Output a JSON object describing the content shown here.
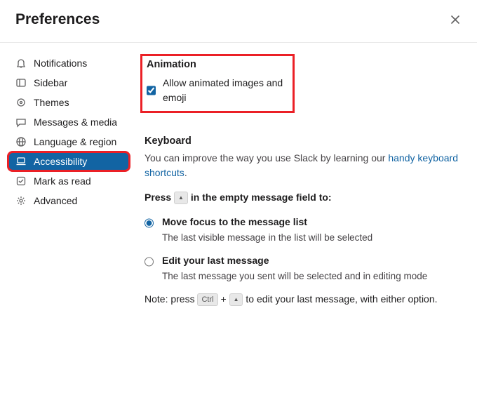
{
  "title": "Preferences",
  "sidebar": {
    "items": [
      {
        "label": "Notifications",
        "icon": "bell-icon",
        "active": false
      },
      {
        "label": "Sidebar",
        "icon": "panel-icon",
        "active": false
      },
      {
        "label": "Themes",
        "icon": "eye-icon",
        "active": false
      },
      {
        "label": "Messages & media",
        "icon": "message-icon",
        "active": false
      },
      {
        "label": "Language & region",
        "icon": "globe-icon",
        "active": false
      },
      {
        "label": "Accessibility",
        "icon": "laptop-icon",
        "active": true
      },
      {
        "label": "Mark as read",
        "icon": "check-icon",
        "active": false
      },
      {
        "label": "Advanced",
        "icon": "gear-icon",
        "active": false
      }
    ]
  },
  "animation": {
    "heading": "Animation",
    "checkbox_label": "Allow animated images and emoji",
    "checked": true
  },
  "keyboard": {
    "heading": "Keyboard",
    "intro": "You can improve the way you use Slack by learning our ",
    "link_text": "handy keyboard shortcuts",
    "press_prefix": "Press",
    "up_key_glyph": "▲",
    "press_suffix": "in the empty message field to:",
    "options": [
      {
        "label": "Move focus to the message list",
        "hint": "The last visible message in the list will be selected",
        "selected": true
      },
      {
        "label": "Edit your last message",
        "hint": "The last message you sent will be selected and in editing mode",
        "selected": false
      }
    ],
    "note_prefix": "Note: press",
    "ctrl_key": "Ctrl",
    "plus": "+",
    "note_suffix": "to edit your last message, with either option."
  }
}
